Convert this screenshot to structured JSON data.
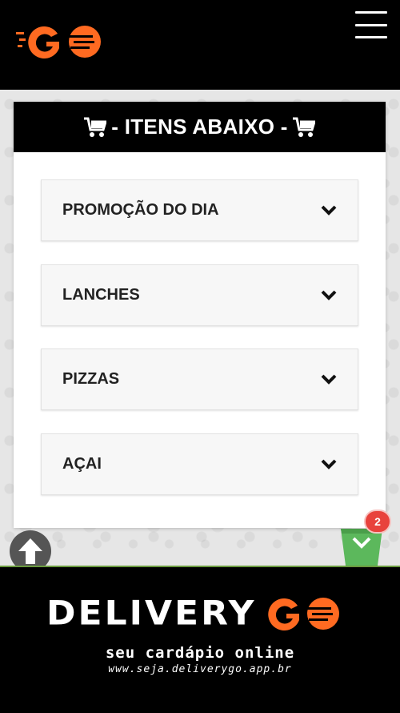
{
  "header": {
    "logo_icon": "deliverygo-logo-icon",
    "menu_icon": "hamburger-menu-icon"
  },
  "card": {
    "title": "- ITENS ABAIXO -",
    "cart_icon": "shopping-cart-icon"
  },
  "categories": [
    {
      "label": "PROMOÇÃO DO DIA",
      "icon": "chevron-down-icon"
    },
    {
      "label": "LANCHES",
      "icon": "chevron-down-icon"
    },
    {
      "label": "PIZZAS",
      "icon": "chevron-down-icon"
    },
    {
      "label": "AÇAI",
      "icon": "chevron-down-icon"
    }
  ],
  "floating": {
    "scroll_top_icon": "arrow-up-icon",
    "basket_icon": "shopping-basket-icon",
    "basket_count": "2"
  },
  "footer": {
    "brand": "DELIVERY",
    "tagline": "seu cardápio online",
    "site": "www.seja.deliverygo.app.br"
  },
  "colors": {
    "brand_orange": "#ff6a21",
    "basket_green": "#5cb85c",
    "badge_red": "#e8423c"
  }
}
